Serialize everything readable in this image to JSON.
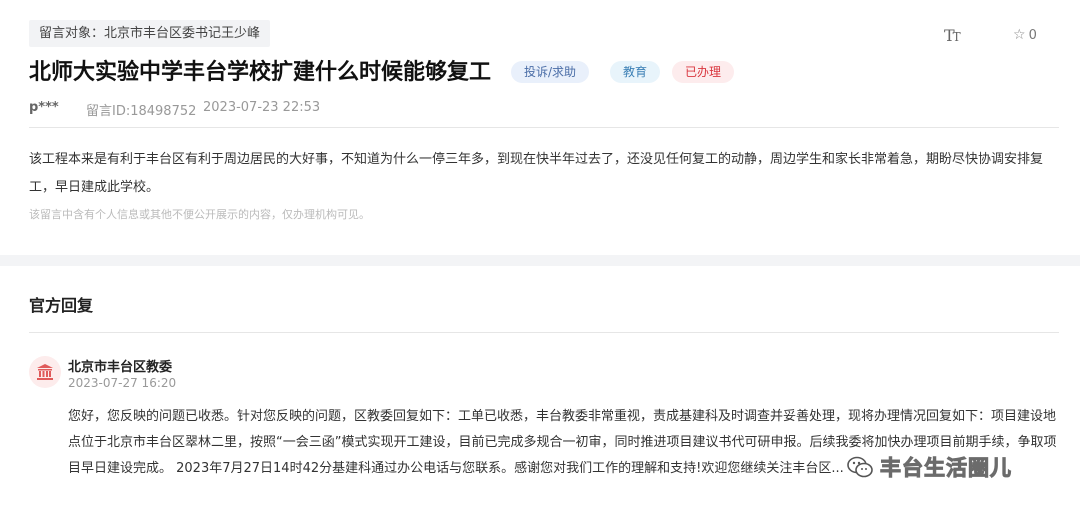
{
  "header": {
    "target_label": "留言对象：北京市丰台区委书记王少峰",
    "font_toggle_icon": "text-size-icon",
    "font_toggle_label": "Tт",
    "favorite_icon": "star-icon",
    "favorite_count": "0"
  },
  "message": {
    "title": "北师大实验中学丰台学校扩建什么时候能够复工",
    "tags": {
      "type": "投诉/求助",
      "field": "教育",
      "status": "已办理"
    },
    "tag_colors": {
      "type": "#4a6da7",
      "field": "#3b7fb5",
      "status": "#d9363e"
    },
    "user": "p***",
    "message_id": "留言ID:18498752",
    "time": "2023-07-23 22:53",
    "content": "该工程本来是有利于丰台区有利于周边居民的大好事，不知道为什么一停三年多，到现在快半年过去了，还没见任何复工的动静，周边学生和家长非常着急，期盼尽快协调安排复工，早日建成此学校。",
    "privacy_notice": "该留言中含有个人信息或其他不便公开展示的内容，仅办理机构可见。"
  },
  "reply": {
    "section_title": "官方回复",
    "org_icon": "government-building-icon",
    "org_name": "北京市丰台区教委",
    "time": "2023-07-27 16:20",
    "content": "您好，您反映的问题已收悉。针对您反映的问题，区教委回复如下：工单已收悉，丰台教委非常重视，责成基建科及时调查并妥善处理，现将办理情况回复如下：项目建设地点位于北京市丰台区翠林二里，按照“一会三函”模式实现开工建设，目前已完成多规合一初审，同时推进项目建议书代可研申报。后续我委将加快办理项目前期手续，争取项目早日建设完成。 2023年7月27日14时42分基建科通过办公电话与您联系。感谢您对我们工作的理解和支持!欢迎您继续关注丰台区..."
  },
  "watermark": {
    "icon": "wechat-icon",
    "text": "丰台生活圈儿"
  }
}
